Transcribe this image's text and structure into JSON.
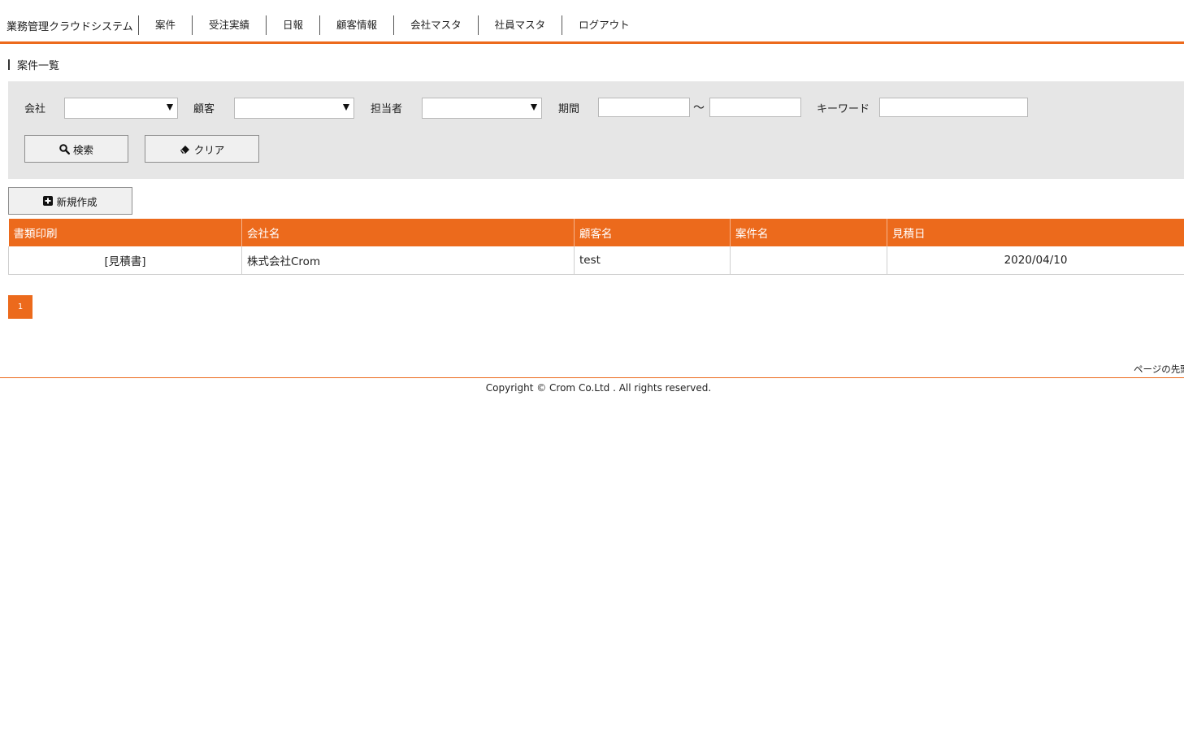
{
  "header": {
    "brand": "業務管理クラウドシステム",
    "nav": [
      "案件",
      "受注実績",
      "日報",
      "顧客情報",
      "会社マスタ",
      "社員マスタ",
      "ログアウト"
    ]
  },
  "page_title": "案件一覧",
  "filter": {
    "company_label": "会社",
    "company_value": "",
    "customer_label": "顧客",
    "customer_value": "",
    "staff_label": "担当者",
    "staff_value": "",
    "period_label": "期間",
    "period_from": "",
    "period_to": "",
    "period_separator": "～",
    "keyword_label": "キーワード",
    "keyword_value": "",
    "search_button": "検索",
    "clear_button": "クリア"
  },
  "new_button": "新規作成",
  "table": {
    "headers": [
      "書類印刷",
      "会社名",
      "顧客名",
      "案件名",
      "見積日"
    ],
    "rows": [
      {
        "print": "[見積書]",
        "company": "株式会社Crom",
        "customer": "test",
        "project": "",
        "estimate_date": "2020/04/10"
      }
    ]
  },
  "pagination": {
    "current_page": "1"
  },
  "footer": {
    "to_top": "ページの先頭",
    "copyright": "Copyright © Crom Co.Ltd . All rights reserved."
  },
  "colors": {
    "accent": "#ec6a1c",
    "panel_bg": "#e6e6e6"
  }
}
